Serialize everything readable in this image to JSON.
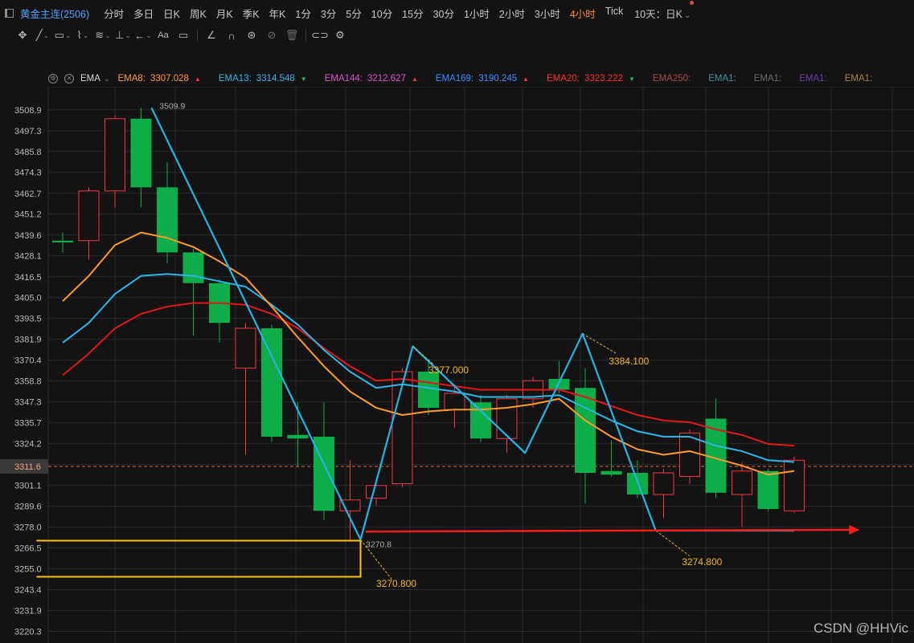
{
  "topbar": {
    "title": "黄金主连(2506)",
    "timeframes": [
      "分时",
      "多日",
      "日K",
      "周K",
      "月K",
      "季K",
      "年K",
      "1分",
      "3分",
      "5分",
      "10分",
      "15分",
      "30分",
      "1小时",
      "2小时",
      "3小时",
      "4小时",
      "Tick"
    ],
    "active_timeframe": "4小时",
    "range_label": "10天：日K"
  },
  "legend": {
    "indicator": "EMA",
    "items": [
      {
        "name": "EMA8:",
        "value": "3307.028",
        "color": "#ff9a2e",
        "trend": "up"
      },
      {
        "name": "EMA13:",
        "value": "3314.548",
        "color": "#2bb6e8",
        "trend": "down"
      },
      {
        "name": "EMA144:",
        "value": "3212.627",
        "color": "#e24fd6",
        "trend": "up"
      },
      {
        "name": "EMA169:",
        "value": "3190.245",
        "color": "#3d8cff",
        "trend": "up"
      },
      {
        "name": "EMA20:",
        "value": "3323.222",
        "color": "#ff2a2a",
        "trend": "down"
      },
      {
        "name": "EMA250:",
        "value": "",
        "color": "#a34a4a",
        "trend": ""
      },
      {
        "name": "EMA1:",
        "value": "",
        "color": "#2a9aa0",
        "trend": ""
      },
      {
        "name": "EMA1:",
        "value": "",
        "color": "#6a6a6a",
        "trend": ""
      },
      {
        "name": "EMA1:",
        "value": "",
        "color": "#6c3fa8",
        "trend": ""
      },
      {
        "name": "EMA1:",
        "value": "",
        "color": "#a9862c",
        "trend": ""
      }
    ]
  },
  "colors": {
    "up": "#f23645",
    "down": "#0dad4a",
    "grid": "#2a2a2c",
    "ema8": "#ff9a2e",
    "ema13": "#2bb6e8",
    "ema20": "#e01818",
    "zigzag": "#22b6e6",
    "box": "#f5c518",
    "arrow": "#f21f1f"
  },
  "chart_data": {
    "type": "candlestick",
    "yticks": [
      "3508.9",
      "3497.3",
      "3485.8",
      "3474.3",
      "3462.7",
      "3451.2",
      "3439.6",
      "3428.1",
      "3416.5",
      "3405.0",
      "3393.5",
      "3381.9",
      "3370.4",
      "3358.8",
      "3347.3",
      "3335.7",
      "3324.2",
      "3301.1",
      "3289.6",
      "3278.0",
      "3266.5",
      "3255.0",
      "3243.4",
      "3231.9",
      "3220.3"
    ],
    "ylim": [
      3216.0,
      3515.0
    ],
    "current_price": "3311.6",
    "current_price_value": 3311.6,
    "candles": [
      {
        "o": 3436.5,
        "h": 3441,
        "c": 3435.5,
        "l": 3430
      },
      {
        "o": 3436.5,
        "h": 3466,
        "c": 3464,
        "l": 3426
      },
      {
        "o": 3464,
        "h": 3506,
        "c": 3504,
        "l": 3455
      },
      {
        "o": 3504,
        "h": 3510,
        "c": 3466,
        "l": 3455
      },
      {
        "o": 3466,
        "h": 3480,
        "c": 3430,
        "l": 3424
      },
      {
        "o": 3430,
        "h": 3432,
        "c": 3413,
        "l": 3384
      },
      {
        "o": 3413,
        "h": 3415,
        "c": 3391,
        "l": 3380
      },
      {
        "o": 3366,
        "h": 3391,
        "c": 3388,
        "l": 3318
      },
      {
        "o": 3388,
        "h": 3390,
        "c": 3328,
        "l": 3325
      },
      {
        "o": 3329,
        "h": 3347,
        "c": 3327,
        "l": 3311
      },
      {
        "o": 3328,
        "h": 3347,
        "c": 3287,
        "l": 3282
      },
      {
        "o": 3287,
        "h": 3315,
        "c": 3293,
        "l": 3271
      },
      {
        "o": 3294,
        "h": 3305,
        "c": 3301,
        "l": 3290
      },
      {
        "o": 3302,
        "h": 3366,
        "c": 3364,
        "l": 3300
      },
      {
        "o": 3364,
        "h": 3371,
        "c": 3344,
        "l": 3340
      },
      {
        "o": 3343,
        "h": 3357,
        "c": 3352,
        "l": 3333
      },
      {
        "o": 3347,
        "h": 3351,
        "c": 3327,
        "l": 3325
      },
      {
        "o": 3327,
        "h": 3351,
        "c": 3349,
        "l": 3319
      },
      {
        "o": 3349,
        "h": 3361,
        "c": 3359,
        "l": 3344
      },
      {
        "o": 3360,
        "h": 3370,
        "c": 3354,
        "l": 3352
      },
      {
        "o": 3355,
        "h": 3366,
        "c": 3308,
        "l": 3291
      },
      {
        "o": 3309,
        "h": 3326,
        "c": 3307,
        "l": 3306
      },
      {
        "o": 3308,
        "h": 3315,
        "c": 3296,
        "l": 3294
      },
      {
        "o": 3296,
        "h": 3310,
        "c": 3308,
        "l": 3283
      },
      {
        "o": 3306,
        "h": 3332,
        "c": 3330,
        "l": 3302
      },
      {
        "o": 3338,
        "h": 3349,
        "c": 3297,
        "l": 3294
      },
      {
        "o": 3296,
        "h": 3314,
        "c": 3309,
        "l": 3278
      },
      {
        "o": 3309,
        "h": 3310,
        "c": 3288,
        "l": 3287
      },
      {
        "o": 3287,
        "h": 3317,
        "c": 3315,
        "l": 3286
      }
    ],
    "ema8": [
      3403,
      3417,
      3434,
      3441,
      3438,
      3433,
      3425,
      3416,
      3400,
      3383,
      3367,
      3353,
      3344,
      3340,
      3342,
      3343,
      3343,
      3344,
      3346,
      3349,
      3337,
      3328,
      3321,
      3318,
      3320,
      3316,
      3312,
      3307,
      3309
    ],
    "ema13": [
      3380,
      3391,
      3407,
      3417,
      3418,
      3417,
      3414,
      3411,
      3401,
      3390,
      3376,
      3364,
      3355,
      3357,
      3355,
      3353,
      3350,
      3350,
      3350,
      3351,
      3344,
      3337,
      3331,
      3328,
      3328,
      3323,
      3320,
      3315,
      3314
    ],
    "ema20": [
      3362,
      3374,
      3388,
      3396,
      3400,
      3402,
      3402,
      3401,
      3396,
      3388,
      3377,
      3367,
      3359,
      3360,
      3358,
      3356,
      3354,
      3354,
      3354,
      3354,
      3350,
      3345,
      3340,
      3337,
      3336,
      3332,
      3329,
      3324,
      3323
    ],
    "zigzag": [
      {
        "i": 3.4,
        "v": 3510
      },
      {
        "i": 11.4,
        "v": 3271
      },
      {
        "i": 13.4,
        "v": 3378
      },
      {
        "i": 17.7,
        "v": 3319
      },
      {
        "i": 19.9,
        "v": 3385
      },
      {
        "i": 22.7,
        "v": 3276
      },
      {
        "i": 28,
        "v": 3276
      }
    ],
    "annotations": [
      {
        "text": "3509.9",
        "i": 3.7,
        "v": 3509.5,
        "color": "#aaaaaa"
      },
      {
        "text": "3377.000",
        "i": 14.0,
        "v": 3363,
        "color": "#f5b90f"
      },
      {
        "text": "3384.100",
        "i": 20.9,
        "v": 3368,
        "color": "#f5b90f"
      },
      {
        "text": "3270.8",
        "i": 11.6,
        "v": 3267,
        "color": "#aaaaaa"
      },
      {
        "text": "3270.800",
        "i": 12.0,
        "v": 3245,
        "color": "#f5b90f"
      },
      {
        "text": "3274.800",
        "i": 23.7,
        "v": 3257,
        "color": "#f5b90f"
      }
    ],
    "guide_lines": [
      {
        "from_i": 13.4,
        "from_v": 3378,
        "to_i": 14.2,
        "to_v": 3368
      },
      {
        "from_i": 19.9,
        "from_v": 3385,
        "to_i": 21.2,
        "to_v": 3374
      },
      {
        "from_i": 11.4,
        "from_v": 3271,
        "to_i": 12.6,
        "to_v": 3249
      },
      {
        "from_i": 22.7,
        "from_v": 3276,
        "to_i": 24.0,
        "to_v": 3262
      }
    ],
    "box": {
      "start_i": -1,
      "end_i": 11.4,
      "top": 3270.5,
      "bottom": 3250.5
    },
    "arrow": {
      "from_i": 11.6,
      "to_i": 30.5,
      "from_v": 3275.5,
      "to_v": 3276.5
    },
    "watermark": "CSDN @HHVic"
  }
}
